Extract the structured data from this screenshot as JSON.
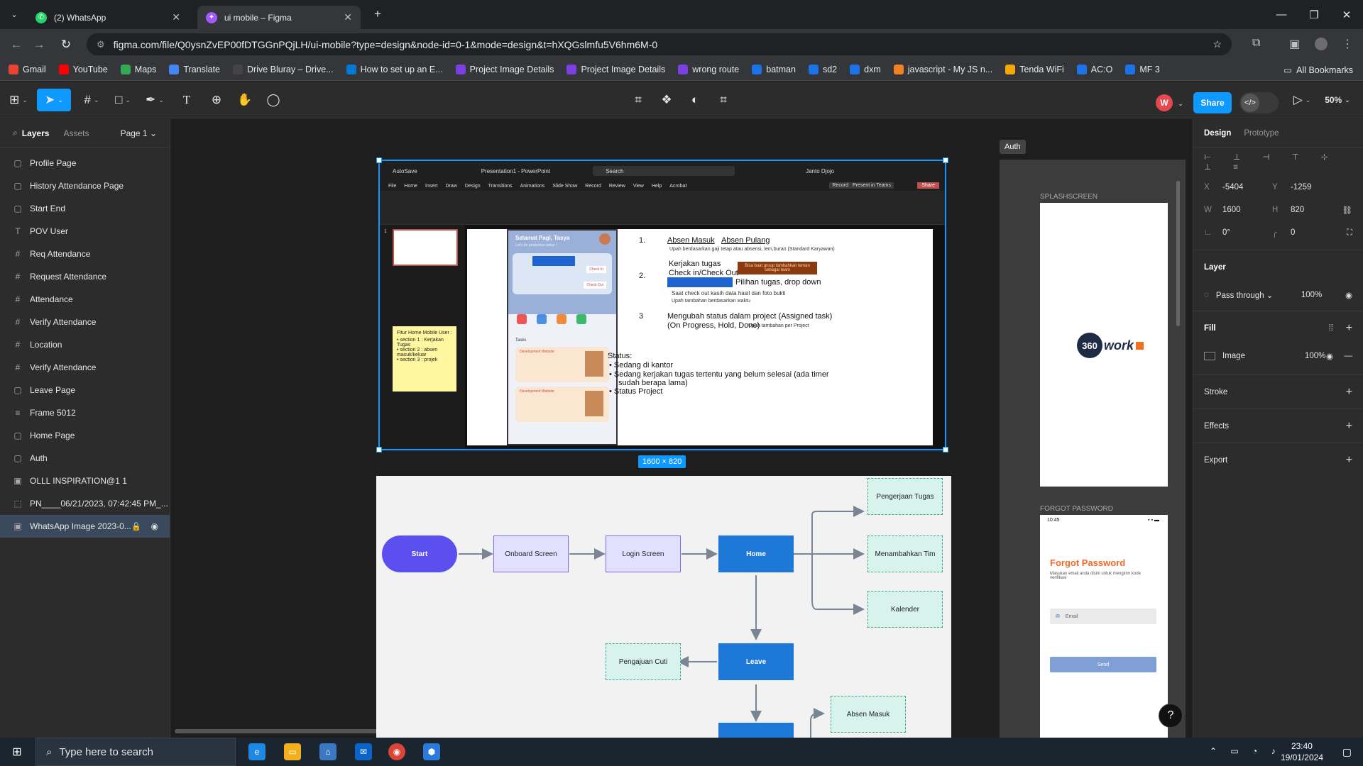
{
  "browser": {
    "tabs": [
      {
        "title": "(2) WhatsApp"
      },
      {
        "title": "ui mobile – Figma"
      }
    ],
    "url": "figma.com/file/Q0ysnZvEP00fDTGGnPQjLH/ui-mobile?type=design&node-id=0-1&mode=design&t=hXQGslmfu5V6hm6M-0",
    "bookmarks": [
      {
        "label": "Gmail",
        "icon": "gmail-icon",
        "color": "#ea4335"
      },
      {
        "label": "YouTube",
        "icon": "youtube-icon",
        "color": "#ff0000"
      },
      {
        "label": "Maps",
        "icon": "maps-icon",
        "color": "#34a853"
      },
      {
        "label": "Translate",
        "icon": "translate-icon",
        "color": "#4285f4"
      },
      {
        "label": "Drive Bluray – Drive...",
        "icon": "drive-icon",
        "color": "#444444"
      },
      {
        "label": "How to set up an E...",
        "icon": "link-icon",
        "color": "#0078d4"
      },
      {
        "label": "Project Image Details",
        "icon": "project-icon",
        "color": "#7b3fe4"
      },
      {
        "label": "Project Image Details",
        "icon": "project-icon",
        "color": "#7b3fe4"
      },
      {
        "label": "wrong route",
        "icon": "project-icon",
        "color": "#7b3fe4"
      },
      {
        "label": "batman",
        "icon": "shield-icon",
        "color": "#1a73e8"
      },
      {
        "label": "sd2",
        "icon": "shield-icon",
        "color": "#1a73e8"
      },
      {
        "label": "dxm",
        "icon": "shield-icon",
        "color": "#1a73e8"
      },
      {
        "label": "javascript - My JS n...",
        "icon": "stack-icon",
        "color": "#f48024"
      },
      {
        "label": "Tenda WiFi",
        "icon": "wifi-icon",
        "color": "#f2a900"
      },
      {
        "label": "AC:O",
        "icon": "shield-icon",
        "color": "#1a73e8"
      },
      {
        "label": "MF 3",
        "icon": "shield-icon",
        "color": "#1a73e8"
      }
    ],
    "all_bookmarks": "All Bookmarks"
  },
  "figma": {
    "avatar_letter": "W",
    "share_label": "Share",
    "zoom": "50%",
    "left_tabs": {
      "layers": "Layers",
      "assets": "Assets",
      "page": "Page 1"
    },
    "layers": [
      {
        "name": "Profile Page",
        "type": "frame"
      },
      {
        "name": "History Attendance Page",
        "type": "frame"
      },
      {
        "name": "Start End",
        "type": "frame"
      },
      {
        "name": "POV User",
        "type": "text"
      },
      {
        "name": "Req Attendance",
        "type": "hash"
      },
      {
        "name": "Request Attendance",
        "type": "hash"
      },
      {
        "name": "Attendance",
        "type": "hash"
      },
      {
        "name": "Verify Attendance",
        "type": "hash"
      },
      {
        "name": "Location",
        "type": "hash"
      },
      {
        "name": "Verify Attendance",
        "type": "hash"
      },
      {
        "name": "Leave Page",
        "type": "frame"
      },
      {
        "name": "Frame 5012",
        "type": "list"
      },
      {
        "name": "Home Page",
        "type": "frame"
      },
      {
        "name": "Auth",
        "type": "frame"
      },
      {
        "name": "OLLL INSPIRATION@1 1",
        "type": "image"
      },
      {
        "name": "PN____06/21/2023, 07:42:45 PM_...",
        "type": "dashed"
      },
      {
        "name": "WhatsApp Image 2023-0...",
        "type": "image"
      }
    ],
    "selected_size": "1600 × 820",
    "auth_label": "Auth",
    "splash_label": "SPLASHSCREEN",
    "forgot_label": "FORGOT PASSWORD",
    "logo_text": "360work",
    "forgot": {
      "time": "10:45",
      "title": "Forgot Password",
      "desc": "Masukan email anda disini untuk mengirim kode verifikasi",
      "email_placeholder": "Email",
      "send": "Send"
    },
    "ppt": {
      "title_left": "AutoSave",
      "title_file": "Presentation1 - PowerPoint",
      "search": "Search",
      "user": "Janto Djojo",
      "menu": [
        "File",
        "Home",
        "Insert",
        "Draw",
        "Design",
        "Transitions",
        "Animations",
        "Slide Show",
        "Record",
        "Review",
        "View",
        "Help",
        "Acrobat"
      ],
      "record": "Record",
      "present": "Present in Teams",
      "share": "Share",
      "slide_num": "1",
      "phone_greet": "Selamat Pagi, Tasya",
      "phone_sub": "Let's be productive today !",
      "phone_checkin": "Check In",
      "phone_checkout": "Check Out",
      "phone_tasks": "Tasks",
      "phone_card": "Development Website",
      "sticky_title": "Fitur Home Mobile User :",
      "sticky_items": [
        "section 1 : Kerjakan Tugas",
        "section 2 : absen masuk/keluar",
        "section 3 : projek"
      ],
      "l1_num": "1.",
      "l1_a": "Absen Masuk",
      "l1_b": "Absen Pulang",
      "l1_note": "Upah berdasarkan gaji tetap atau absensi, lem,buran (Standard Karyawan)",
      "l2_num": "2.",
      "l2_a": "Kerjakan tugas",
      "l2_b": "Check in/Check Out",
      "l2_box": "Bisa buat group tambahkan teman sebagai team",
      "l2_c": "Pilihan tugas, drop down",
      "l2_d": "Saat check out kasih data hasil dan foto bukti",
      "l2_e": "Upah tambahan berdasarkan waktu",
      "l3_num": "3",
      "l3_a": "Mengubah status dalam project (Assigned task)",
      "l3_b": "(On Progress, Hold, Done)",
      "l3_note": "Upah tambahan per Project",
      "status_title": "Status:",
      "status_items": [
        "Sedang di kantor",
        "Sedang kerjakan tugas tertentu yang belum selesai (ada timer",
        "sudah berapa lama)",
        "Status Project"
      ]
    },
    "flow": {
      "start": "Start",
      "onboard": "Onboard Screen",
      "login": "Login Screen",
      "home": "Home",
      "leave": "Leave",
      "pengerjaan": "Pengerjaan Tugas",
      "menambahkan": "Menambahkan Tim",
      "kalender": "Kalender",
      "cuti": "Pengajuan Cuti",
      "absen": "Absen Masuk"
    },
    "design": {
      "tabs": {
        "design": "Design",
        "prototype": "Prototype"
      },
      "x": "-5404",
      "y": "-1259",
      "w": "1600",
      "h": "820",
      "rotation": "0°",
      "radius": "0",
      "x_lbl": "X",
      "y_lbl": "Y",
      "w_lbl": "W",
      "h_lbl": "H",
      "layer_title": "Layer",
      "blend": "Pass through",
      "opacity": "100%",
      "fill_title": "Fill",
      "fill_type": "Image",
      "fill_opacity": "100%",
      "stroke": "Stroke",
      "effects": "Effects",
      "export": "Export"
    }
  },
  "taskbar": {
    "search": "Type here to search",
    "time": "23:40",
    "date": "19/01/2024"
  }
}
